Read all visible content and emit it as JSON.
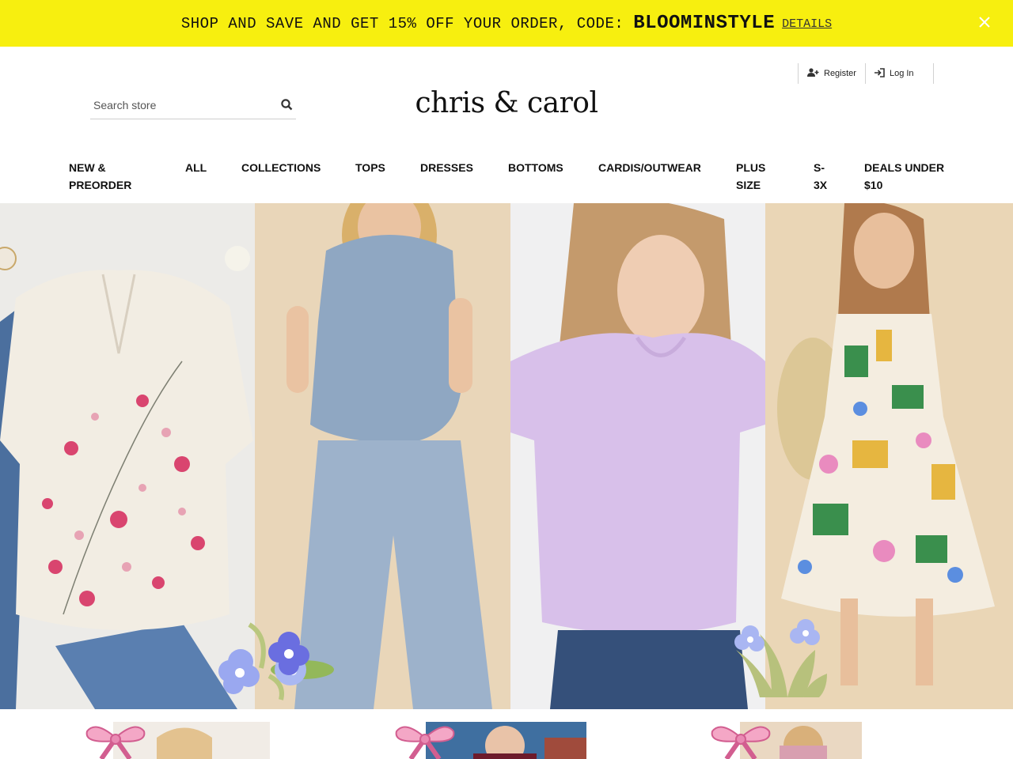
{
  "promo": {
    "text": "SHOP AND SAVE AND GET 15% OFF YOUR ORDER, CODE:",
    "code": "BLOOMINSTYLE",
    "details": "DETAILS",
    "close_icon": "close-icon"
  },
  "account": {
    "register": "Register",
    "login": "Log In"
  },
  "search": {
    "placeholder": "Search store",
    "icon": "search-icon"
  },
  "brand": {
    "logo": "chris & carol"
  },
  "nav": {
    "items": [
      {
        "line1": "NEW &",
        "line2": "PREORDER"
      },
      {
        "line1": "ALL",
        "line2": ""
      },
      {
        "line1": "COLLECTIONS",
        "line2": ""
      },
      {
        "line1": "TOPS",
        "line2": ""
      },
      {
        "line1": "DRESSES",
        "line2": ""
      },
      {
        "line1": "BOTTOMS",
        "line2": ""
      },
      {
        "line1": "CARDIS/OUTWEAR",
        "line2": ""
      },
      {
        "line1": "PLUS",
        "line2": "SIZE"
      },
      {
        "line1": "S-",
        "line2": "3X"
      },
      {
        "line1": "DEALS UNDER",
        "line2": "$10"
      }
    ]
  },
  "colors": {
    "banner": "#f7ef0f",
    "text": "#111111"
  }
}
